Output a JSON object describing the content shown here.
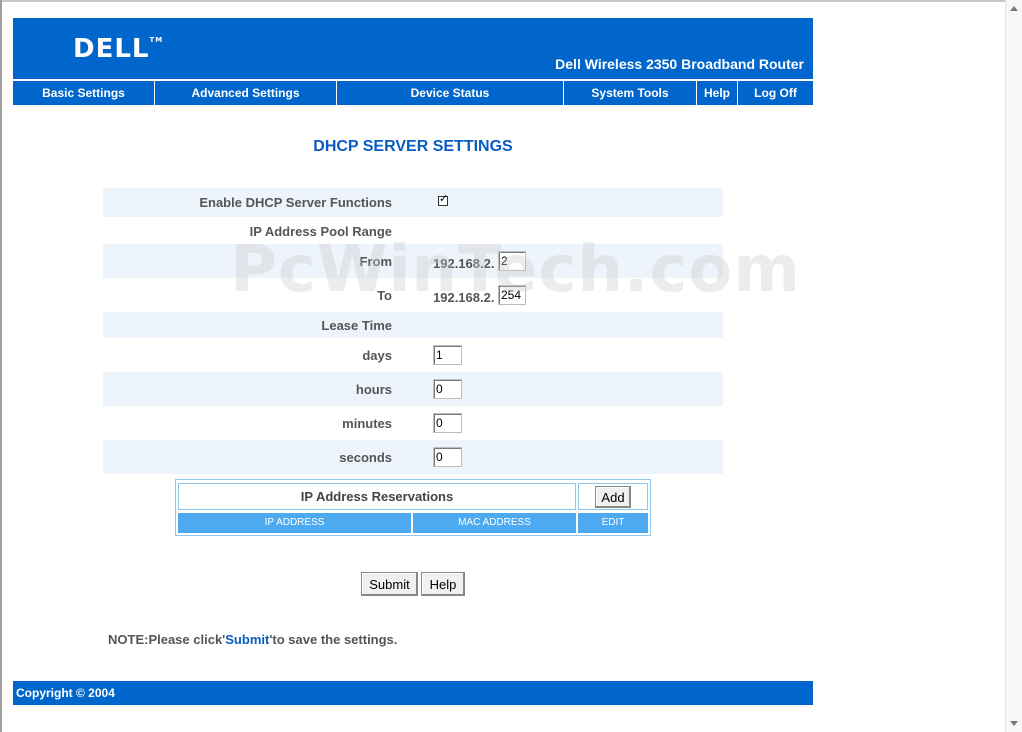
{
  "header": {
    "logo": "DELL",
    "logo_tm": "TM",
    "product_name": "Dell Wireless 2350 Broadband Router"
  },
  "nav": {
    "items": [
      {
        "label": "Basic Settings"
      },
      {
        "label": "Advanced Settings"
      },
      {
        "label": "Device Status"
      },
      {
        "label": "System Tools"
      },
      {
        "label": "Help"
      },
      {
        "label": "Log Off"
      }
    ]
  },
  "page": {
    "title": "DHCP SERVER SETTINGS",
    "watermark": "PcWinTech.com"
  },
  "form": {
    "enable_dhcp_label": "Enable DHCP Server Functions",
    "enable_dhcp_checked": true,
    "ip_pool_label": "IP Address Pool Range",
    "from_label": "From",
    "from_prefix": "192.168.2.",
    "from_value": "2",
    "to_label": "To",
    "to_prefix": "192.168.2.",
    "to_value": "254",
    "lease_time_label": "Lease Time",
    "days_label": "days",
    "days_value": "1",
    "hours_label": "hours",
    "hours_value": "0",
    "minutes_label": "minutes",
    "minutes_value": "0",
    "seconds_label": "seconds",
    "seconds_value": "0"
  },
  "reservations": {
    "title": "IP Address Reservations",
    "add_label": "Add",
    "columns": [
      "IP ADDRESS",
      "MAC ADDRESS",
      "EDIT"
    ]
  },
  "actions": {
    "submit_label": "Submit",
    "help_label": "Help"
  },
  "note": {
    "prefix": "NOTE:Please click'",
    "link": "Submit",
    "suffix": "'to save the settings."
  },
  "footer": {
    "copyright": "Copyright © 2004"
  },
  "colors": {
    "brand_blue": "#0066cc",
    "title_blue": "#0a5cc4",
    "table_header_blue": "#4daaf0",
    "row_shade": "#eef4fb"
  }
}
